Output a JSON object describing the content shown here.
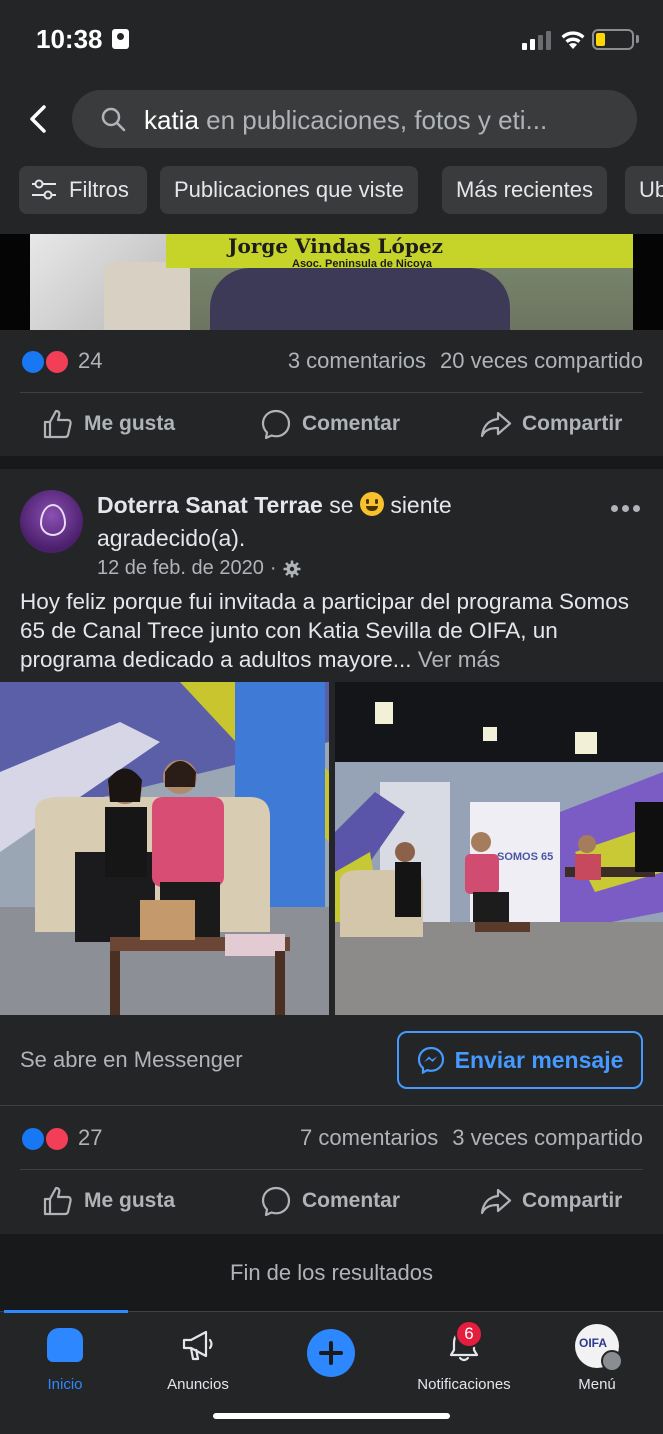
{
  "status_bar": {
    "time": "10:38"
  },
  "search": {
    "query": "katia",
    "hint": " en publicaciones, fotos y eti..."
  },
  "filters": [
    {
      "label": "Filtros"
    },
    {
      "label": "Publicaciones que viste"
    },
    {
      "label": "Más recientes"
    },
    {
      "label": "Ub"
    }
  ],
  "post1": {
    "video_title": "Jorge Vindas López",
    "video_subtitle": "Asoc. Peninsula de Nicoya",
    "reaction_count": "24",
    "comments": "3 comentarios",
    "shares": "20 veces compartido"
  },
  "post2": {
    "author": "Doterra Sanat Terrae",
    "feeling_prefix": "se",
    "feeling": "siente agradecido(a).",
    "date": "12 de feb. de 2020",
    "text": "Hoy  feliz porque fui invitada a participar del programa Somos 65 de Canal Trece junto con Katia Sevilla de OIFA, un programa dedicado a adultos mayore...",
    "see_more": "Ver más",
    "cta_text": "Se abre en Messenger",
    "cta_button": "Enviar mensaje",
    "reaction_count": "27",
    "comments": "7 comentarios",
    "shares": "3 veces compartido",
    "photo_sign": "SOMOS 65"
  },
  "actions": {
    "like": "Me gusta",
    "comment": "Comentar",
    "share": "Compartir"
  },
  "end_of_results": "Fin de los resultados",
  "tabbar": {
    "home": "Inicio",
    "ads": "Anuncios",
    "notifications": "Notificaciones",
    "notifications_badge": "6",
    "menu": "Menú",
    "menu_avatar_text": "OIFA"
  },
  "colors": {
    "accent": "#2d88ff",
    "background": "#18191a",
    "card": "#242526",
    "badge": "#e41e3f",
    "battery": "#ffd60a"
  },
  "icons": [
    "back-arrow-icon",
    "search-icon",
    "filter-sliders-icon",
    "like-icon",
    "love-icon",
    "thumbs-up-icon",
    "comment-bubble-icon",
    "share-arrow-icon",
    "more-dots-icon",
    "gear-icon",
    "messenger-icon",
    "home-icon",
    "megaphone-icon",
    "plus-icon",
    "bell-icon"
  ]
}
